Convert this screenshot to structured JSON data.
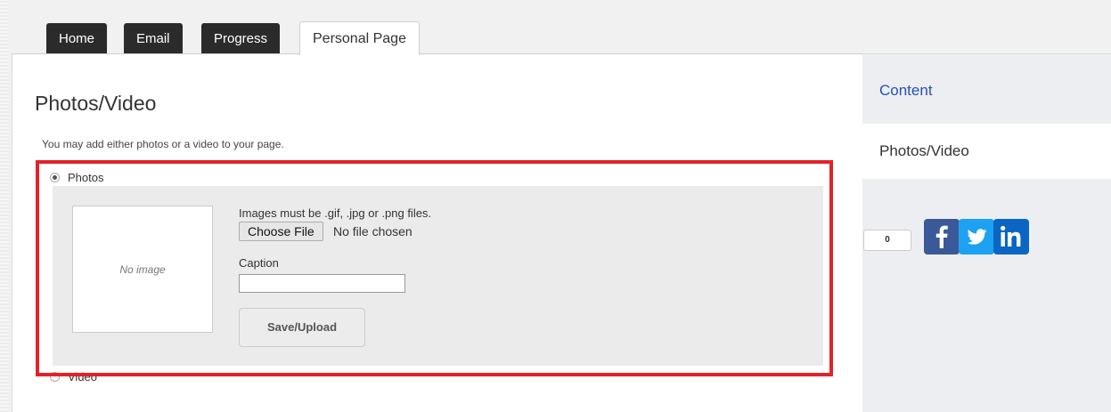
{
  "tabs": [
    {
      "label": "Home"
    },
    {
      "label": "Email"
    },
    {
      "label": "Progress"
    },
    {
      "label": "Personal Page"
    }
  ],
  "main": {
    "title": "Photos/Video",
    "intro": "You may add either photos or a video to your page.",
    "photos_option": "Photos",
    "video_option": "Video",
    "preview_text": "No image",
    "file_hint": "Images must be .gif, .jpg or .png files.",
    "choose_file": "Choose File",
    "file_status": "No file chosen",
    "caption_label": "Caption",
    "caption_value": "",
    "save_label": "Save/Upload"
  },
  "sidebar": {
    "content_link": "Content",
    "active_item": "Photos/Video",
    "share_count": "0"
  },
  "icons": {
    "facebook": "facebook-icon",
    "twitter": "twitter-icon",
    "linkedin": "linkedin-icon"
  },
  "colors": {
    "highlight": "#e32228",
    "facebook": "#3b5998",
    "twitter": "#1da1f2",
    "linkedin": "#0a66c2",
    "link": "#2a4fb3"
  }
}
